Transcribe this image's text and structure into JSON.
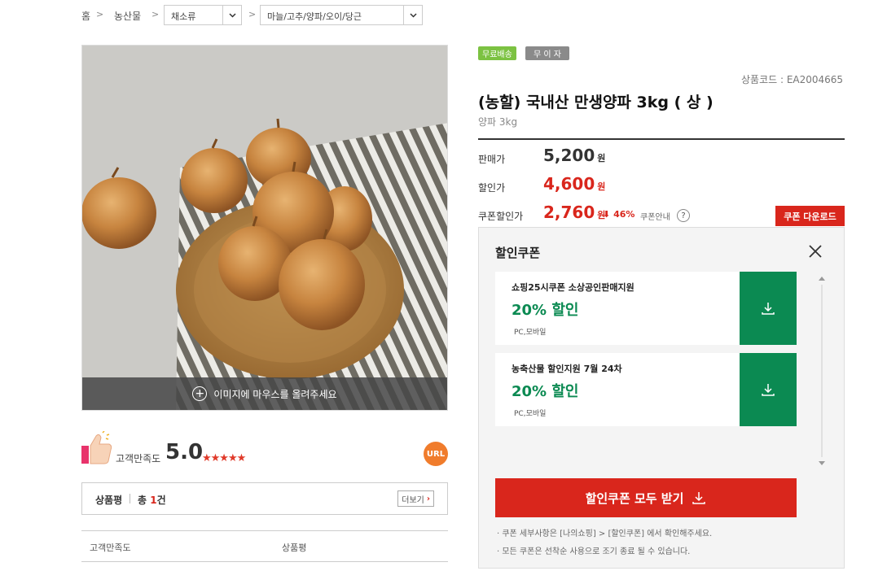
{
  "breadcrumb": {
    "home": "홈",
    "category": "농산물",
    "select1": "채소류",
    "select2": "마늘/고추/양파/오이/당근"
  },
  "image": {
    "hover_text": "이미지에 마우스를 올려주세요"
  },
  "rating": {
    "label": "고객만족도",
    "score": "5.0",
    "stars": "★★★★★",
    "url_button": "URL"
  },
  "reviews": {
    "title": "상품평",
    "total_prefix": "총 ",
    "total_count": "1",
    "total_suffix": "건",
    "more": "더보기",
    "col_satisfaction": "고객만족도",
    "col_review": "상품평"
  },
  "badges": {
    "free_shipping": "무료배송",
    "no_interest": "무 이 자"
  },
  "product": {
    "code": "상품코드 : EA2004665",
    "title": "(농할) 국내산 만생양파 3kg ( 상 )",
    "subtitle": "양파 3kg"
  },
  "prices": {
    "sale_label": "판매가",
    "sale_value": "5,200",
    "discount_label": "할인가",
    "discount_value": "4,600",
    "coupon_label": "쿠폰할인가",
    "coupon_value": "2,760",
    "won": "원",
    "rate": "46%",
    "coupon_info": "쿠폰안내",
    "help": "?"
  },
  "coupon_download": "쿠폰 다운로드",
  "panel": {
    "title": "할인쿠폰",
    "coupons": [
      {
        "name": "쇼핑25시쿠폰 소상공인판매지원",
        "percent": "20% 할인",
        "platform": "PC,모바일"
      },
      {
        "name": "농축산물 할인지원 7월 24차",
        "percent": "20% 할인",
        "platform": "PC,모바일"
      }
    ],
    "get_all": "할인쿠폰 모두 받기",
    "notes": [
      "·  쿠폰 세부사항은 [나의쇼핑] > [할인쿠폰] 에서 확인해주세요.",
      "·  모든 쿠폰은 선착순 사용으로 조기 종료 될 수 있습니다."
    ]
  },
  "colors": {
    "accent_red": "#d9261c",
    "coupon_green": "#0b8a52",
    "badge_green": "#7cc242",
    "badge_gray": "#8a8a8a",
    "url_orange": "#f07c2c"
  }
}
